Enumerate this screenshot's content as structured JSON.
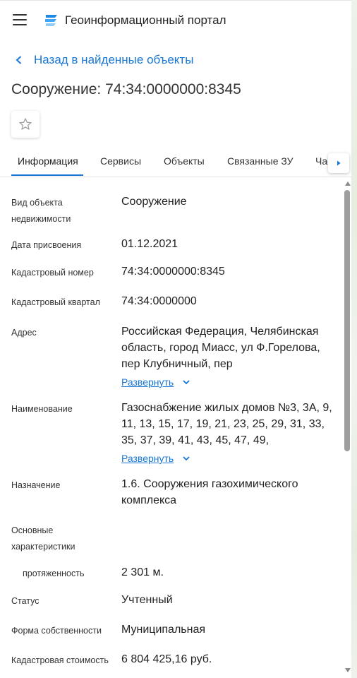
{
  "header": {
    "title": "Геоинформационный портал"
  },
  "nav": {
    "back_label": "Назад в найденные объекты"
  },
  "object": {
    "title": "Сооружение: 74:34:0000000:8345"
  },
  "tabs": [
    {
      "label": "Информация"
    },
    {
      "label": "Сервисы"
    },
    {
      "label": "Объекты"
    },
    {
      "label": "Связанные ЗУ"
    },
    {
      "label": "Части"
    }
  ],
  "info": {
    "kind_label": "Вид объекта недвижимости",
    "kind_value": "Сооружение",
    "date_label": "Дата присвоения",
    "date_value": "01.12.2021",
    "cad_num_label": "Кадастровый номер",
    "cad_num_value": "74:34:0000000:8345",
    "cad_quarter_label": "Кадастровый квартал",
    "cad_quarter_value": "74:34:0000000",
    "address_label": "Адрес",
    "address_value": "Российская Федерация, Челябинская область, город Миасс, ул Ф.Горелова, пер Клубничный, пер",
    "name_label": "Наименование",
    "name_value": "Газоснабжение жилых домов №3, 3А, 9, 11, 13, 15, 17, 19, 21, 23, 25, 29, 31, 33, 35, 37, 39, 41, 43, 45, 47, 49,",
    "expand_label": "Развернуть",
    "purpose_label": "Назначение",
    "purpose_value": "1.6. Сооружения газохимического комплекса",
    "chars_label": "Основные характеристики",
    "length_label": "протяженность",
    "length_value": "2 301 м.",
    "status_label": "Статус",
    "status_value": "Учтенный",
    "ownership_label": "Форма собственности",
    "ownership_value": "Муниципальная",
    "cost_label": "Кадастровая стоимость",
    "cost_value": "6 804 425,16 руб."
  },
  "colors": {
    "accent": "#1976d2",
    "text": "#222222"
  }
}
